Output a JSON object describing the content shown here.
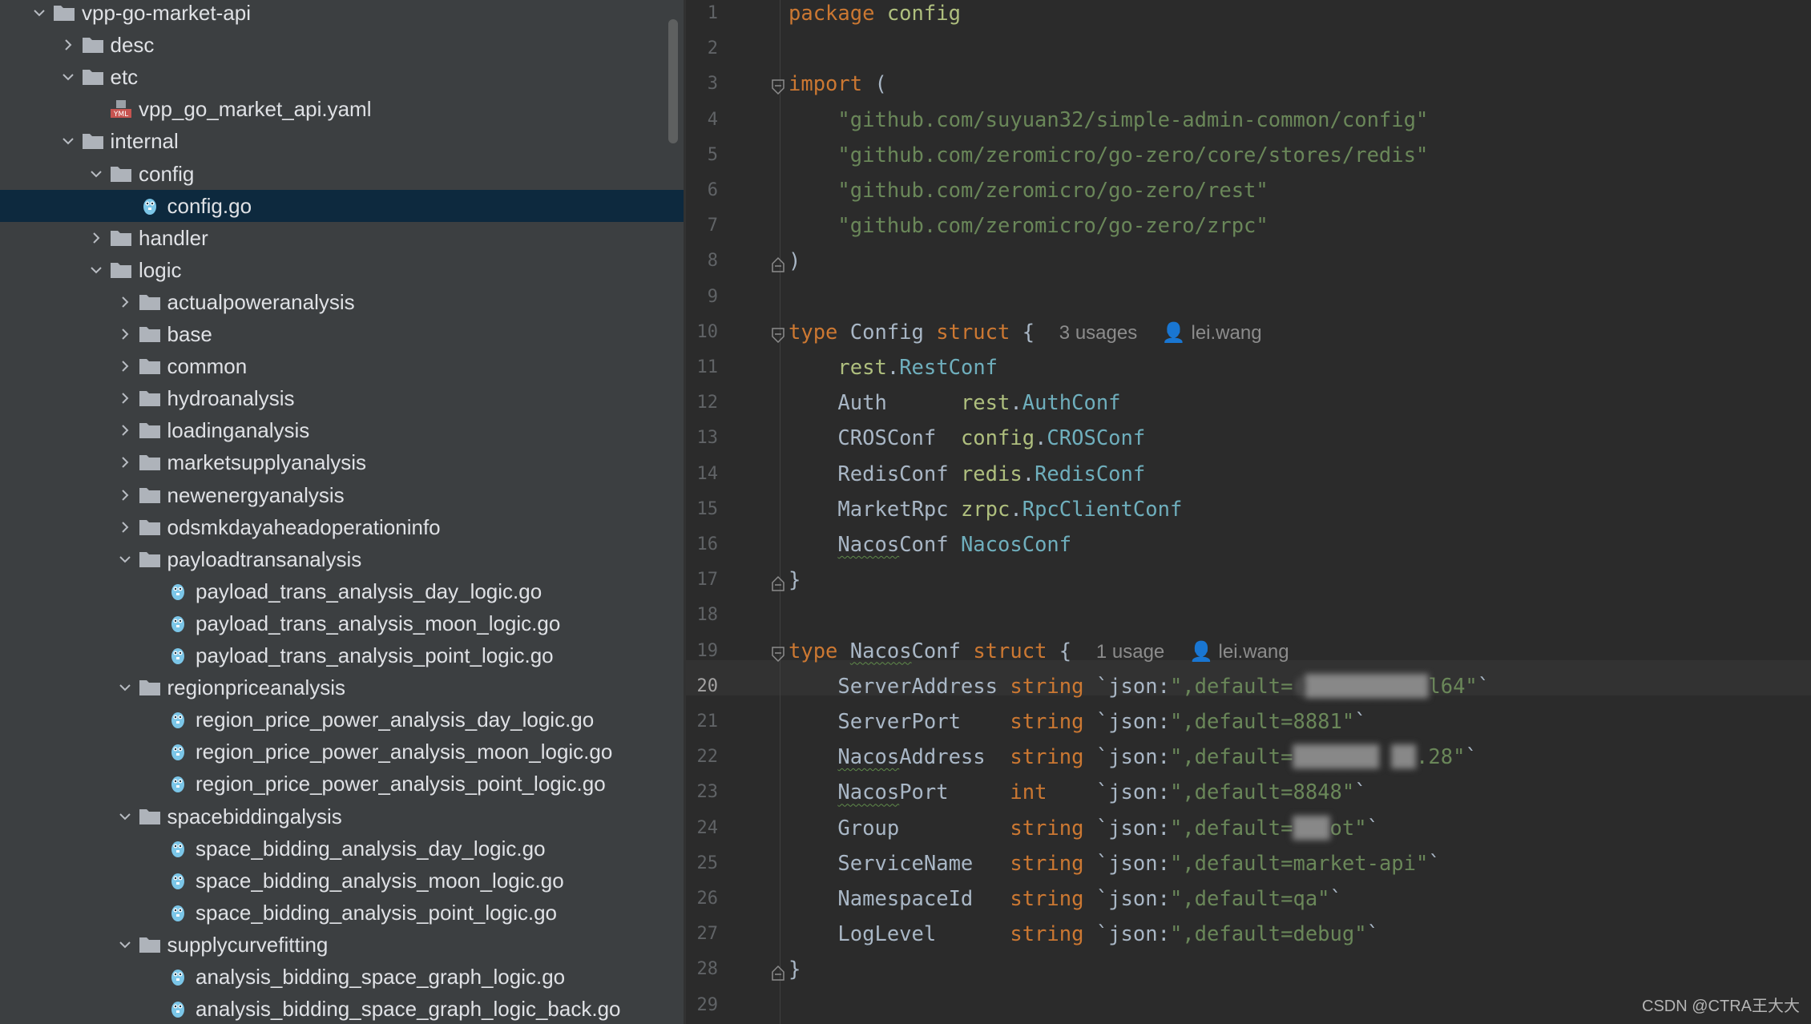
{
  "tree": {
    "rows": [
      {
        "label": "vpp-go-market-api",
        "depth": 0,
        "kind": "folder",
        "state": "open"
      },
      {
        "label": "desc",
        "depth": 1,
        "kind": "folder",
        "state": "closed"
      },
      {
        "label": "etc",
        "depth": 1,
        "kind": "folder",
        "state": "open"
      },
      {
        "label": "vpp_go_market_api.yaml",
        "depth": 2,
        "kind": "yaml"
      },
      {
        "label": "internal",
        "depth": 1,
        "kind": "folder",
        "state": "open"
      },
      {
        "label": "config",
        "depth": 2,
        "kind": "folder",
        "state": "open"
      },
      {
        "label": "config.go",
        "depth": 3,
        "kind": "go",
        "selected": true
      },
      {
        "label": "handler",
        "depth": 2,
        "kind": "folder",
        "state": "closed"
      },
      {
        "label": "logic",
        "depth": 2,
        "kind": "folder",
        "state": "open"
      },
      {
        "label": "actualpoweranalysis",
        "depth": 3,
        "kind": "folder",
        "state": "closed"
      },
      {
        "label": "base",
        "depth": 3,
        "kind": "folder",
        "state": "closed"
      },
      {
        "label": "common",
        "depth": 3,
        "kind": "folder",
        "state": "closed"
      },
      {
        "label": "hydroanalysis",
        "depth": 3,
        "kind": "folder",
        "state": "closed"
      },
      {
        "label": "loadinganalysis",
        "depth": 3,
        "kind": "folder",
        "state": "closed"
      },
      {
        "label": "marketsupplyanalysis",
        "depth": 3,
        "kind": "folder",
        "state": "closed"
      },
      {
        "label": "newenergyanalysis",
        "depth": 3,
        "kind": "folder",
        "state": "closed"
      },
      {
        "label": "odsmkdayaheadoperationinfo",
        "depth": 3,
        "kind": "folder",
        "state": "closed"
      },
      {
        "label": "payloadtransanalysis",
        "depth": 3,
        "kind": "folder",
        "state": "open"
      },
      {
        "label": "payload_trans_analysis_day_logic.go",
        "depth": 4,
        "kind": "go"
      },
      {
        "label": "payload_trans_analysis_moon_logic.go",
        "depth": 4,
        "kind": "go"
      },
      {
        "label": "payload_trans_analysis_point_logic.go",
        "depth": 4,
        "kind": "go"
      },
      {
        "label": "regionpriceanalysis",
        "depth": 3,
        "kind": "folder",
        "state": "open"
      },
      {
        "label": "region_price_power_analysis_day_logic.go",
        "depth": 4,
        "kind": "go"
      },
      {
        "label": "region_price_power_analysis_moon_logic.go",
        "depth": 4,
        "kind": "go"
      },
      {
        "label": "region_price_power_analysis_point_logic.go",
        "depth": 4,
        "kind": "go"
      },
      {
        "label": "spacebiddingalysis",
        "depth": 3,
        "kind": "folder",
        "state": "open"
      },
      {
        "label": "space_bidding_analysis_day_logic.go",
        "depth": 4,
        "kind": "go"
      },
      {
        "label": "space_bidding_analysis_moon_logic.go",
        "depth": 4,
        "kind": "go"
      },
      {
        "label": "space_bidding_analysis_point_logic.go",
        "depth": 4,
        "kind": "go"
      },
      {
        "label": "supplycurvefitting",
        "depth": 3,
        "kind": "folder",
        "state": "open"
      },
      {
        "label": "analysis_bidding_space_graph_logic.go",
        "depth": 4,
        "kind": "go"
      },
      {
        "label": "analysis_bidding_space_graph_logic_back.go",
        "depth": 4,
        "kind": "go"
      }
    ]
  },
  "editor": {
    "current_line": 20,
    "lines": [
      {
        "n": "1",
        "tokens": [
          {
            "t": "package",
            "c": "kw"
          },
          {
            "t": " "
          },
          {
            "t": "config",
            "c": "pkg"
          }
        ]
      },
      {
        "n": "2",
        "tokens": []
      },
      {
        "n": "3",
        "fold": "open",
        "tokens": [
          {
            "t": "import",
            "c": "kw"
          },
          {
            "t": " ("
          }
        ]
      },
      {
        "n": "4",
        "tokens": [
          {
            "t": "    "
          },
          {
            "t": "\"github.com/suyuan32/simple-admin-common/config\"",
            "c": "str"
          }
        ]
      },
      {
        "n": "5",
        "tokens": [
          {
            "t": "    "
          },
          {
            "t": "\"github.com/zeromicro/go-zero/core/stores/redis\"",
            "c": "str"
          }
        ]
      },
      {
        "n": "6",
        "tokens": [
          {
            "t": "    "
          },
          {
            "t": "\"github.com/zeromicro/go-zero/rest\"",
            "c": "str"
          }
        ]
      },
      {
        "n": "7",
        "tokens": [
          {
            "t": "    "
          },
          {
            "t": "\"github.com/zeromicro/go-zero/zrpc\"",
            "c": "str"
          }
        ]
      },
      {
        "n": "8",
        "fold": "close",
        "tokens": [
          {
            "t": ")"
          }
        ]
      },
      {
        "n": "9",
        "tokens": []
      },
      {
        "n": "10",
        "fold": "open",
        "tokens": [
          {
            "t": "type",
            "c": "kw"
          },
          {
            "t": " Config "
          },
          {
            "t": "struct",
            "c": "kw"
          },
          {
            "t": " {  "
          },
          {
            "t": "3 usages",
            "c": "hint"
          },
          {
            "t": "  "
          },
          {
            "t": "👤",
            "c": "hint person"
          },
          {
            "t": " lei.wang",
            "c": "hint"
          }
        ]
      },
      {
        "n": "11",
        "tokens": [
          {
            "t": "    "
          },
          {
            "t": "rest",
            "c": "pkg"
          },
          {
            "t": "."
          },
          {
            "t": "RestConf",
            "c": "ty"
          }
        ]
      },
      {
        "n": "12",
        "tokens": [
          {
            "t": "    Auth      "
          },
          {
            "t": "rest",
            "c": "pkg"
          },
          {
            "t": "."
          },
          {
            "t": "AuthConf",
            "c": "ty"
          }
        ]
      },
      {
        "n": "13",
        "tokens": [
          {
            "t": "    CROSConf  "
          },
          {
            "t": "config",
            "c": "pkg"
          },
          {
            "t": "."
          },
          {
            "t": "CROSConf",
            "c": "ty"
          }
        ]
      },
      {
        "n": "14",
        "tokens": [
          {
            "t": "    RedisConf "
          },
          {
            "t": "redis",
            "c": "pkg"
          },
          {
            "t": "."
          },
          {
            "t": "RedisConf",
            "c": "ty"
          }
        ]
      },
      {
        "n": "15",
        "tokens": [
          {
            "t": "    MarketRpc "
          },
          {
            "t": "zrpc",
            "c": "pkg"
          },
          {
            "t": "."
          },
          {
            "t": "RpcClientConf",
            "c": "ty"
          }
        ]
      },
      {
        "n": "16",
        "tokens": [
          {
            "t": "    "
          },
          {
            "t": "Nacos",
            "c": "wavy"
          },
          {
            "t": "Conf "
          },
          {
            "t": "NacosConf",
            "c": "ty"
          }
        ]
      },
      {
        "n": "17",
        "fold": "close",
        "tokens": [
          {
            "t": "}"
          }
        ]
      },
      {
        "n": "18",
        "tokens": []
      },
      {
        "n": "19",
        "fold": "open",
        "tokens": [
          {
            "t": "type",
            "c": "kw"
          },
          {
            "t": " "
          },
          {
            "t": "Nacos",
            "c": "wavy"
          },
          {
            "t": "Conf "
          },
          {
            "t": "struct",
            "c": "kw"
          },
          {
            "t": " {  "
          },
          {
            "t": "1 usage",
            "c": "hint"
          },
          {
            "t": "  "
          },
          {
            "t": "👤",
            "c": "hint person"
          },
          {
            "t": " lei.wang",
            "c": "hint"
          }
        ]
      },
      {
        "n": "20",
        "tokens": [
          {
            "t": "    ServerAddress "
          },
          {
            "t": "string",
            "c": "kw"
          },
          {
            "t": " `"
          },
          {
            "t": "json:",
            "c": "tag"
          },
          {
            "t": "\",default=",
            "c": "str"
          },
          {
            "t": "(██████████",
            "c": "blur"
          },
          {
            "t": "l64\"",
            "c": "str"
          },
          {
            "t": "`"
          }
        ]
      },
      {
        "n": "21",
        "tokens": [
          {
            "t": "    ServerPort    "
          },
          {
            "t": "string",
            "c": "kw"
          },
          {
            "t": " `"
          },
          {
            "t": "json:",
            "c": "tag"
          },
          {
            "t": "\",default=8881\"",
            "c": "str"
          },
          {
            "t": "`"
          }
        ]
      },
      {
        "n": "22",
        "tokens": [
          {
            "t": "    "
          },
          {
            "t": "Nacos",
            "c": "wavy"
          },
          {
            "t": "Address  "
          },
          {
            "t": "string",
            "c": "kw"
          },
          {
            "t": " `"
          },
          {
            "t": "json:",
            "c": "tag"
          },
          {
            "t": "\",default=",
            "c": "str"
          },
          {
            "t": "███████ ██",
            "c": "blur"
          },
          {
            "t": ".28\"",
            "c": "str"
          },
          {
            "t": "`"
          }
        ]
      },
      {
        "n": "23",
        "tokens": [
          {
            "t": "    "
          },
          {
            "t": "Nacos",
            "c": "wavy"
          },
          {
            "t": "Port     "
          },
          {
            "t": "int",
            "c": "kw"
          },
          {
            "t": "    `"
          },
          {
            "t": "json:",
            "c": "tag"
          },
          {
            "t": "\",default=8848\"",
            "c": "str"
          },
          {
            "t": "`"
          }
        ]
      },
      {
        "n": "24",
        "tokens": [
          {
            "t": "    Group         "
          },
          {
            "t": "string",
            "c": "kw"
          },
          {
            "t": " `"
          },
          {
            "t": "json:",
            "c": "tag"
          },
          {
            "t": "\",default=",
            "c": "str"
          },
          {
            "t": "███",
            "c": "blur"
          },
          {
            "t": "ot\"",
            "c": "str"
          },
          {
            "t": "`"
          }
        ]
      },
      {
        "n": "25",
        "tokens": [
          {
            "t": "    ServiceName   "
          },
          {
            "t": "string",
            "c": "kw"
          },
          {
            "t": " `"
          },
          {
            "t": "json:",
            "c": "tag"
          },
          {
            "t": "\",default=market-api\"",
            "c": "str"
          },
          {
            "t": "`"
          }
        ]
      },
      {
        "n": "26",
        "tokens": [
          {
            "t": "    NamespaceId   "
          },
          {
            "t": "string",
            "c": "kw"
          },
          {
            "t": " `"
          },
          {
            "t": "json:",
            "c": "tag"
          },
          {
            "t": "\",default=qa\"",
            "c": "str"
          },
          {
            "t": "`"
          }
        ]
      },
      {
        "n": "27",
        "tokens": [
          {
            "t": "    LogLevel      "
          },
          {
            "t": "string",
            "c": "kw"
          },
          {
            "t": " `"
          },
          {
            "t": "json:",
            "c": "tag"
          },
          {
            "t": "\",default=debug\"",
            "c": "str"
          },
          {
            "t": "`"
          }
        ]
      },
      {
        "n": "28",
        "fold": "close",
        "tokens": [
          {
            "t": "}"
          }
        ]
      },
      {
        "n": "29",
        "tokens": []
      }
    ]
  },
  "watermark": "CSDN @CTRA王大大",
  "colors": {
    "tree_bg": "#3c3f41",
    "editor_bg": "#2b2b2b",
    "selection": "#0d293e",
    "keyword": "#cc7832",
    "string": "#6a8759",
    "package": "#afbf7e",
    "type": "#6fafbd"
  }
}
